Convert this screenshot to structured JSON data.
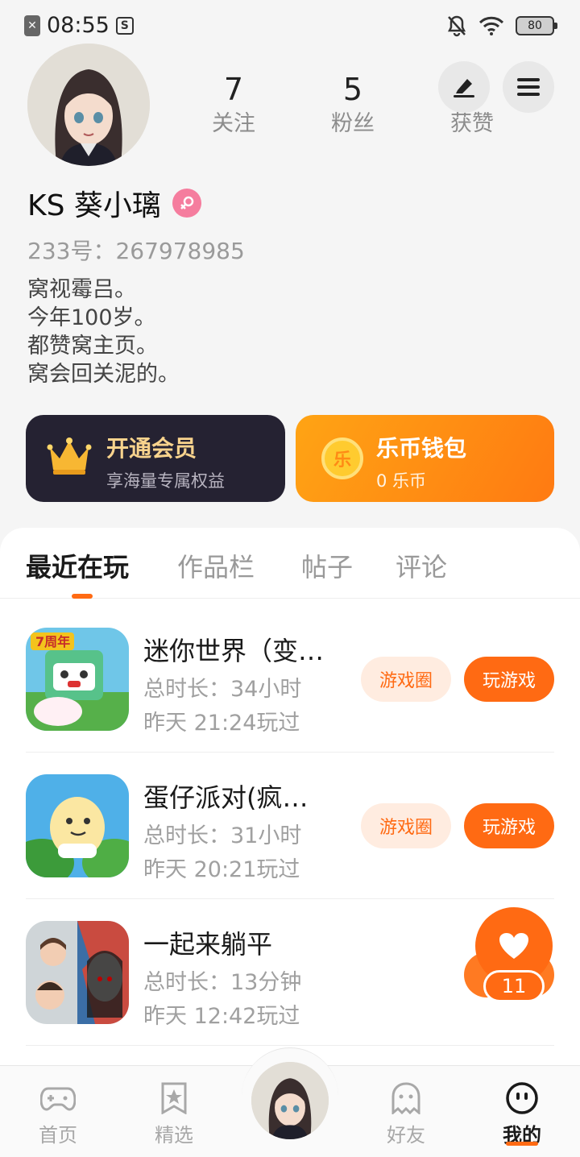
{
  "status_bar": {
    "time": "08:55",
    "sim_icon": "sim-x-icon",
    "notification_icon": "s-icon",
    "battery": "80"
  },
  "profile": {
    "following_count": "7",
    "following_label": "关注",
    "fans_count": "5",
    "fans_label": "粉丝",
    "likes_label": "获赞",
    "username": "KS 葵小璃",
    "gender": "female",
    "uid": "233号：267978985",
    "bio": [
      "窝视霉吕。",
      "今年100岁。",
      "都赞窝主页。",
      "窝会回关泥的。"
    ]
  },
  "cards": {
    "vip_title": "开通会员",
    "vip_sub": "享海量专属权益",
    "wallet_coin": "乐",
    "wallet_title": "乐币钱包",
    "wallet_sub": "0 乐币"
  },
  "tabs": [
    "最近在玩",
    "作品栏",
    "帖子",
    "评论"
  ],
  "games": [
    {
      "name": "迷你世界（变…",
      "duration": "总时长：34小时",
      "last_played": "昨天 21:24玩过",
      "circle_label": "游戏圈",
      "play_label": "玩游戏"
    },
    {
      "name": "蛋仔派对(疯…",
      "duration": "总时长：31小时",
      "last_played": "昨天 20:21玩过",
      "circle_label": "游戏圈",
      "play_label": "玩游戏"
    },
    {
      "name": "一起来躺平",
      "duration": "总时长：13分钟",
      "last_played": "昨天 12:42玩过"
    }
  ],
  "like_fab": {
    "count": "11"
  },
  "bottom_nav": [
    {
      "label": "首页",
      "icon": "gamepad-icon"
    },
    {
      "label": "精选",
      "icon": "star-bookmark-icon"
    },
    {
      "label": "",
      "icon": "avatar"
    },
    {
      "label": "好友",
      "icon": "ghost-icon"
    },
    {
      "label": "我的",
      "icon": "smiley-icon"
    }
  ],
  "colors": {
    "accent": "#ff6a13",
    "vip_bg": "#252232",
    "vip_text": "#f8d38d",
    "gender_pink": "#f57d9e"
  }
}
